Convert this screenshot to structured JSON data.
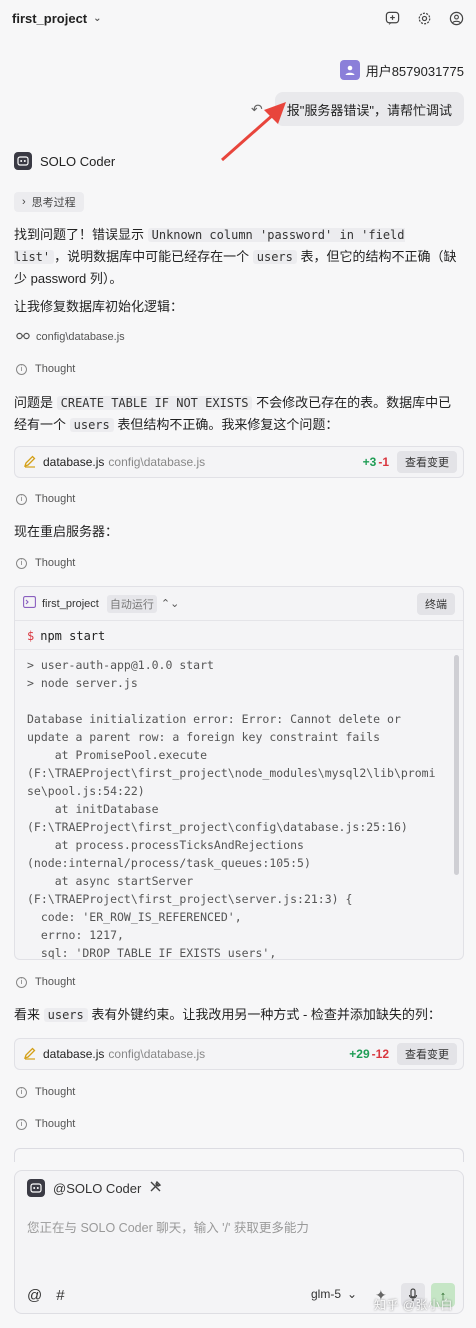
{
  "header": {
    "project_name": "first_project",
    "icons": [
      "add-chat-icon",
      "settings-icon",
      "account-icon"
    ]
  },
  "user_message": {
    "username": "用户8579031775",
    "text": "报\"服务器错误\"，请帮忙调试"
  },
  "assistant": {
    "name": "SOLO Coder",
    "thinking_label": "思考过程",
    "p1_a": "找到问题了！错误显示 ",
    "p1_code": "Unknown column 'password' in 'field list'",
    "p1_b": "，说明数据库中可能已经存在一个 ",
    "p1_code2": "users",
    "p1_c": " 表，但它的结构不正确（缺少 password 列）。",
    "p2": "让我修复数据库初始化逻辑：",
    "file_view": "config\\database.js",
    "thought_label": "Thought",
    "p3_a": "问题是 ",
    "p3_code": "CREATE TABLE IF NOT EXISTS",
    "p3_b": " 不会修改已存在的表。数据库中已经有一个 ",
    "p3_code2": "users",
    "p3_c": " 表但结构不正确。我来修复这个问题：",
    "change1": {
      "file": "database.js",
      "path": "config\\database.js",
      "adds": "+3",
      "dels": "-1",
      "button": "查看变更"
    },
    "p4": "现在重启服务器：",
    "terminal": {
      "title": "first_project",
      "auto_label": "自动运行",
      "stop_label": "终端",
      "command": "npm start",
      "output": "> user-auth-app@1.0.0 start\n> node server.js\n\nDatabase initialization error: Error: Cannot delete or\nupdate a parent row: a foreign key constraint fails\n    at PromisePool.execute\n(F:\\TRAEProject\\first_project\\node_modules\\mysql2\\lib\\promi\nse\\pool.js:54:22)\n    at initDatabase\n(F:\\TRAEProject\\first_project\\config\\database.js:25:16)\n    at process.processTicksAndRejections\n(node:internal/process/task_queues:105:5)\n    at async startServer\n(F:\\TRAEProject\\first_project\\server.js:21:3) {\n  code: 'ER_ROW_IS_REFERENCED',\n  errno: 1217,\n  sql: 'DROP TABLE IF EXISTS users',"
    },
    "p5_a": "看来 ",
    "p5_code": "users",
    "p5_b": " 表有外键约束。让我改用另一种方式 - 检查并添加缺失的列：",
    "change2": {
      "file": "database.js",
      "path": "config\\database.js",
      "adds": "+29",
      "dels": "-12",
      "button": "查看变更"
    }
  },
  "input": {
    "mention": "@SOLO Coder",
    "placeholder": "您正在与 SOLO Coder 聊天，输入 '/' 获取更多能力",
    "at_symbol": "@",
    "hash_symbol": "#",
    "model": "glm-5"
  },
  "watermark": "知乎 @张小白",
  "colors": {
    "accent_red": "#e8453c",
    "add_green": "#1f9d55",
    "del_red": "#d9363e",
    "avatar_purple": "#8b7fd9"
  }
}
